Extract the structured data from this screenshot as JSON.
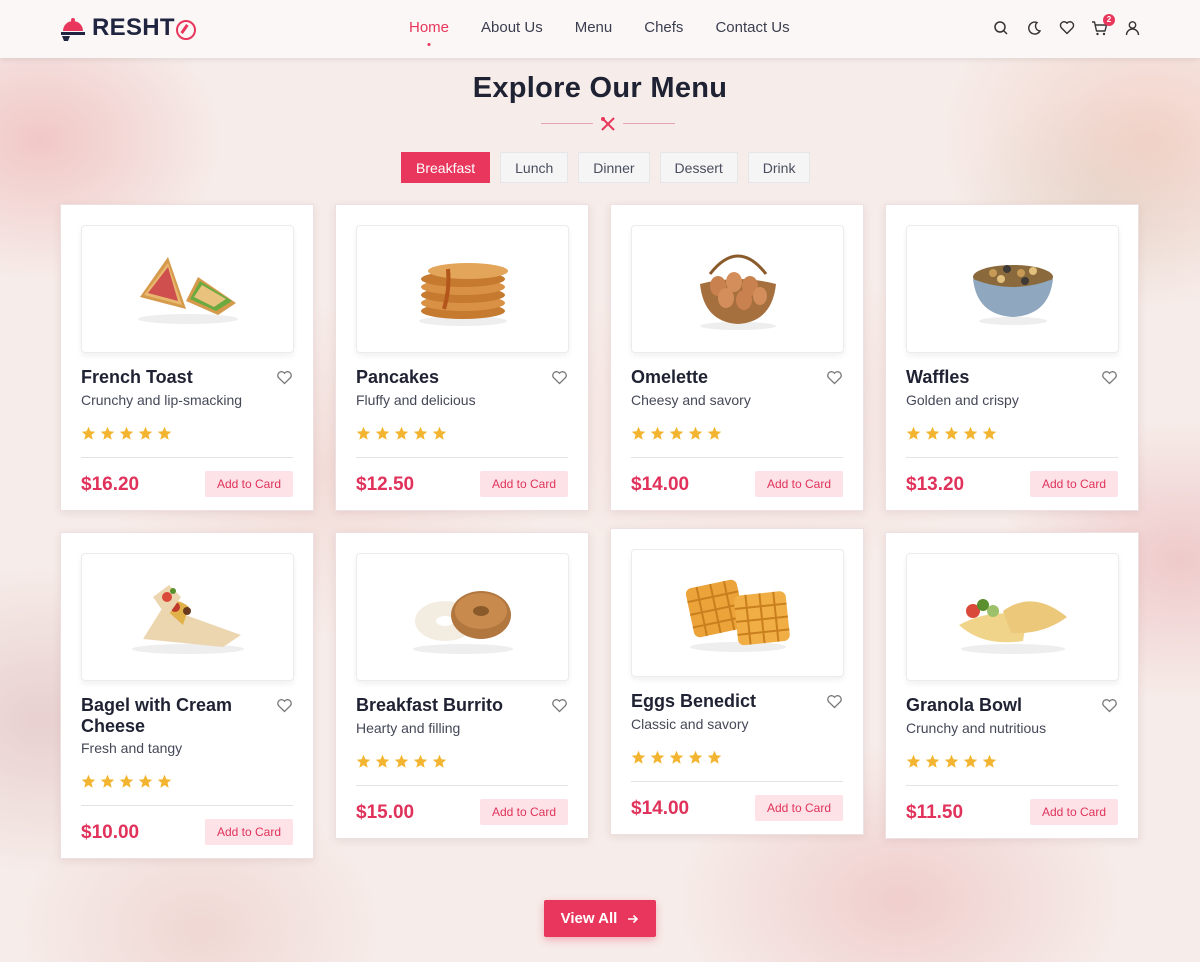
{
  "brand": {
    "name": "RESHT",
    "accent": "#e8365c"
  },
  "nav": {
    "items": [
      {
        "label": "Home",
        "active": true
      },
      {
        "label": "About Us"
      },
      {
        "label": "Menu"
      },
      {
        "label": "Chefs"
      },
      {
        "label": "Contact Us"
      }
    ]
  },
  "header_icons": [
    "search-icon",
    "moon-icon",
    "heart-icon",
    "cart-icon",
    "user-icon"
  ],
  "cart_count": "2",
  "section": {
    "title": "Explore Our Menu"
  },
  "tabs": [
    "Breakfast",
    "Lunch",
    "Dinner",
    "Dessert",
    "Drink"
  ],
  "active_tab": "Breakfast",
  "menu": [
    {
      "name": "French Toast",
      "desc": "Crunchy and lip-smacking",
      "price": "$16.20",
      "rating": 5,
      "cta": "Add to Card",
      "image": "sandwich"
    },
    {
      "name": "Pancakes",
      "desc": "Fluffy and delicious",
      "price": "$12.50",
      "rating": 5,
      "cta": "Add to Card",
      "image": "pancakes"
    },
    {
      "name": "Omelette",
      "desc": "Cheesy and savory",
      "price": "$14.00",
      "rating": 5,
      "cta": "Add to Card",
      "image": "egg-basket"
    },
    {
      "name": "Waffles",
      "desc": "Golden and crispy",
      "price": "$13.20",
      "rating": 5,
      "cta": "Add to Card",
      "image": "granola-bowl"
    },
    {
      "name": "Bagel with Cream Cheese",
      "desc": "Fresh and tangy",
      "price": "$10.00",
      "rating": 5,
      "cta": "Add to Card",
      "image": "burrito"
    },
    {
      "name": "Breakfast Burrito",
      "desc": "Hearty and filling",
      "price": "$15.00",
      "rating": 5,
      "cta": "Add to Card",
      "image": "bagel"
    },
    {
      "name": "Eggs Benedict",
      "desc": "Classic and savory",
      "price": "$14.00",
      "rating": 5,
      "cta": "Add to Card",
      "image": "waffles"
    },
    {
      "name": "Granola Bowl",
      "desc": "Crunchy and nutritious",
      "price": "$11.50",
      "rating": 5,
      "cta": "Add to Card",
      "image": "crepe"
    }
  ],
  "view_all_label": "View All"
}
